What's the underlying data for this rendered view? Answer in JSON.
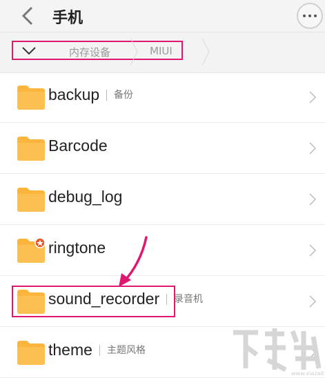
{
  "header": {
    "title": "手机"
  },
  "breadcrumb": {
    "items": [
      "内存设备",
      "MIUI"
    ]
  },
  "files": [
    {
      "name": "backup",
      "desc": "备份"
    },
    {
      "name": "Barcode",
      "desc": ""
    },
    {
      "name": "debug_log",
      "desc": ""
    },
    {
      "name": "ringtone",
      "desc": ""
    },
    {
      "name": "sound_recorder",
      "desc": "录音机"
    },
    {
      "name": "theme",
      "desc": "主题风格"
    }
  ],
  "watermark": {
    "url": "www.xiazaiba.com"
  },
  "colors": {
    "folder": "#fbb43c",
    "highlight": "#e0176f",
    "badge": "#e35a2a"
  },
  "icons": [
    "back-arrow-icon",
    "more-icon",
    "chevron-down-icon",
    "folder-icon",
    "chevron-right-icon"
  ]
}
